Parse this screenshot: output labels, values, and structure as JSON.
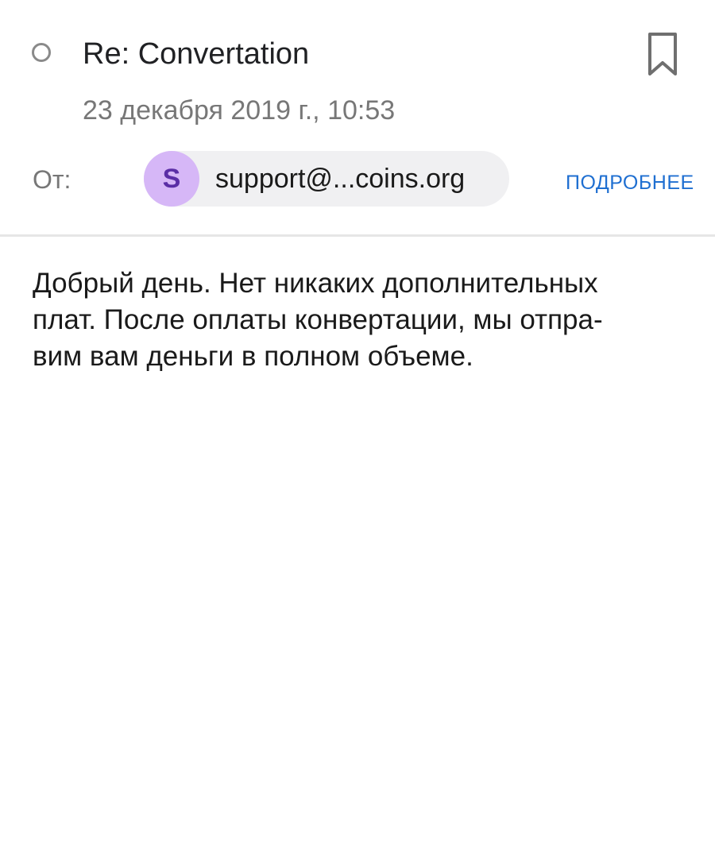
{
  "message": {
    "subject": "Re: Convertation",
    "date": "23 декабря 2019 г., 10:53",
    "from_label": "От:",
    "sender": {
      "avatar_letter": "S",
      "email": "support@...coins.org"
    },
    "details_label": "ПОДРОБНЕЕ",
    "body_lines": [
      "Добрый день. Нет никаких дополнительных",
      "плат. После оплаты конвертации, мы отпра-",
      "вим вам деньги в полном объеме."
    ]
  },
  "icons": {
    "unread": "unread-circle-icon",
    "bookmark": "bookmark-icon"
  },
  "colors": {
    "link": "#1f6fd1",
    "avatar_bg": "#d6b7f7",
    "avatar_text": "#5b2ea6",
    "chip_bg": "#f0f0f2",
    "muted_text": "#777777"
  }
}
